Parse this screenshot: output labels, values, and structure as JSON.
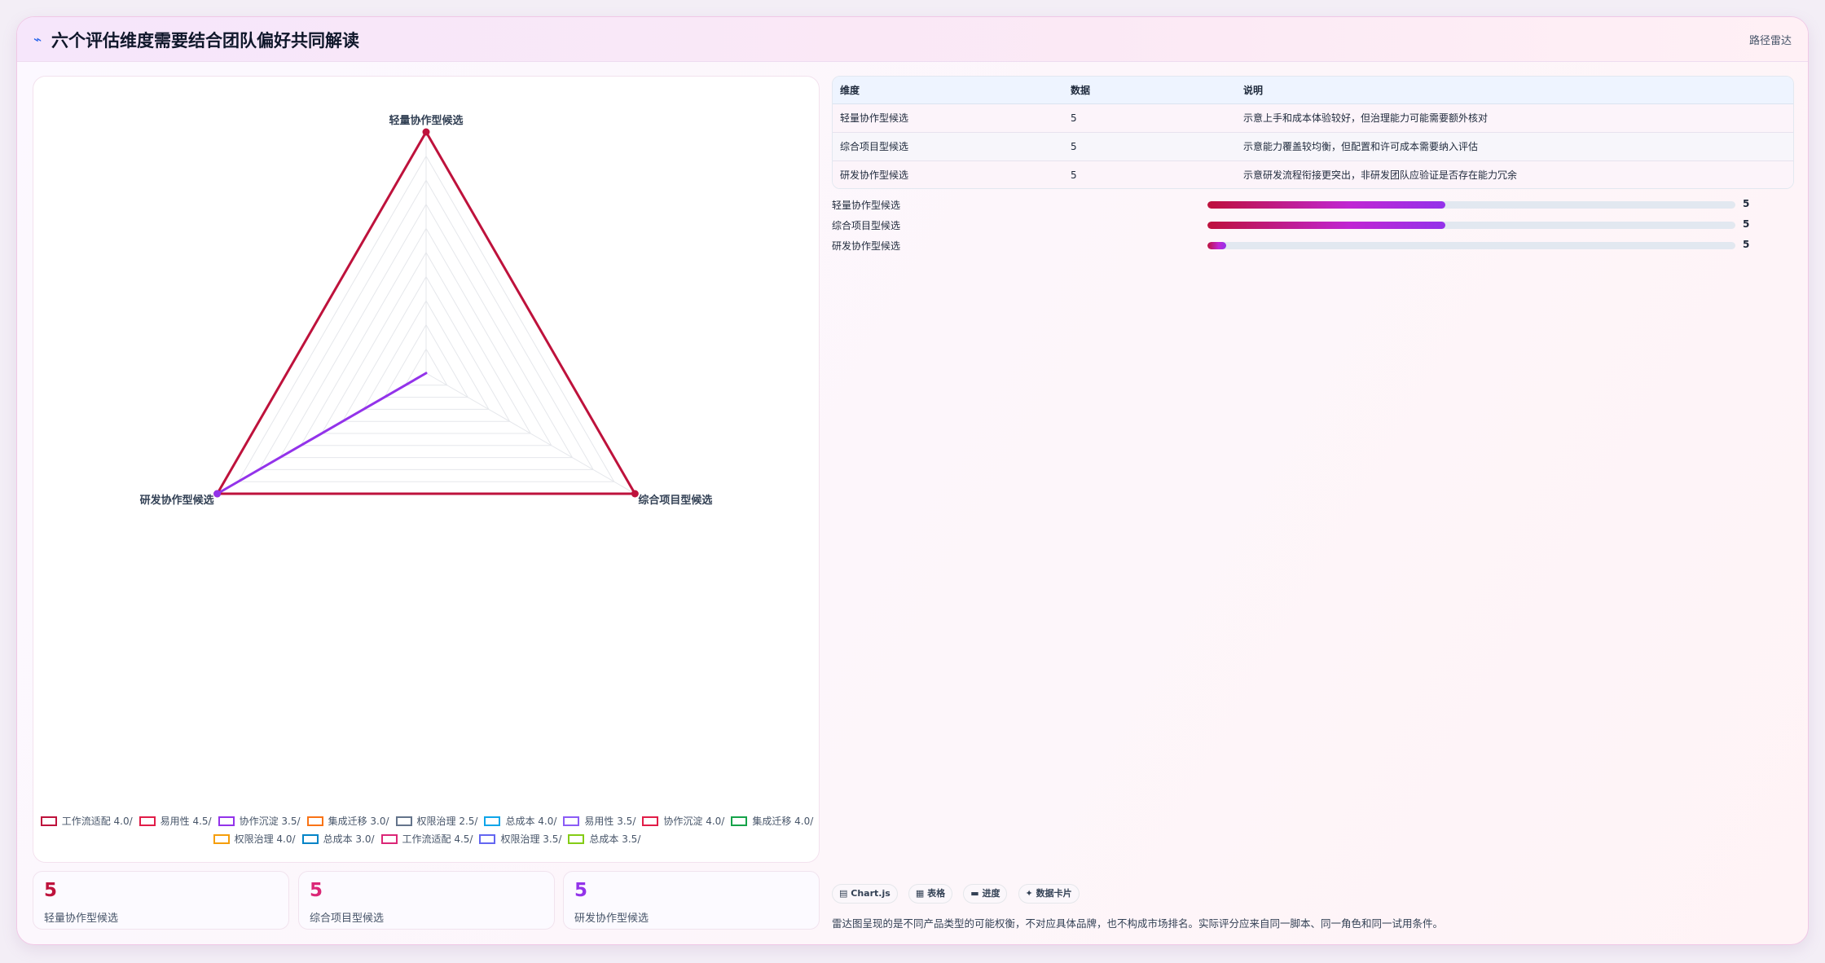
{
  "header": {
    "icon": "chart-tilde-icon",
    "title": "六个评估维度需要结合团队偏好共同解读",
    "tag": "路径雷达"
  },
  "chart_data": {
    "type": "radar",
    "axes": [
      "轻量协作型候选",
      "综合项目型候选",
      "研发协作型候选"
    ],
    "r_range": [
      0,
      5
    ],
    "grid": true,
    "legend_placement": "bottom",
    "series": [
      {
        "name": "工作流适配 4.0/",
        "color": "#be123c",
        "values": [
          5,
          5,
          5
        ]
      },
      {
        "name": "易用性 4.5/",
        "color": "#e11d48",
        "values": [
          null,
          null,
          null
        ]
      },
      {
        "name": "协作沉淀 3.5/",
        "color": "#9333ea",
        "values": [
          0,
          0,
          5
        ]
      },
      {
        "name": "集成迁移 3.0/",
        "color": "#f97316",
        "values": [
          null,
          null,
          null
        ]
      },
      {
        "name": "权限治理 2.5/",
        "color": "#64748b",
        "values": [
          null,
          null,
          null
        ]
      },
      {
        "name": "总成本 4.0/",
        "color": "#0ea5e9",
        "values": [
          null,
          null,
          null
        ]
      },
      {
        "name": "易用性 3.5/",
        "color": "#8b5cf6",
        "values": [
          null,
          null,
          null
        ]
      },
      {
        "name": "协作沉淀 4.0/",
        "color": "#e11d48",
        "values": [
          null,
          null,
          null
        ]
      },
      {
        "name": "集成迁移 4.0/",
        "color": "#16a34a",
        "values": [
          null,
          null,
          null
        ]
      },
      {
        "name": "权限治理 4.0/",
        "color": "#f59e0b",
        "values": [
          null,
          null,
          null
        ]
      },
      {
        "name": "总成本 3.0/",
        "color": "#0284c7",
        "values": [
          null,
          null,
          null
        ]
      },
      {
        "name": "工作流适配 4.5/",
        "color": "#db2777",
        "values": [
          null,
          null,
          null
        ]
      },
      {
        "name": "权限治理 3.5/",
        "color": "#6366f1",
        "values": [
          null,
          null,
          null
        ]
      },
      {
        "name": "总成本 3.5/",
        "color": "#84cc16",
        "values": [
          null,
          null,
          null
        ]
      }
    ]
  },
  "stats": [
    {
      "value": "5",
      "label": "轻量协作型候选",
      "color": "#be123c"
    },
    {
      "value": "5",
      "label": "综合项目型候选",
      "color": "#db2777"
    },
    {
      "value": "5",
      "label": "研发协作型候选",
      "color": "#9333ea"
    }
  ],
  "table": {
    "headers": [
      "维度",
      "数据",
      "说明"
    ],
    "rows": [
      [
        "轻量协作型候选",
        "5",
        "示意上手和成本体验较好，但治理能力可能需要额外核对"
      ],
      [
        "综合项目型候选",
        "5",
        "示意能力覆盖较均衡，但配置和许可成本需要纳入评估"
      ],
      [
        "研发协作型候选",
        "5",
        "示意研发流程衔接更突出，非研发团队应验证是否存在能力冗余"
      ]
    ]
  },
  "progress": [
    {
      "label": "轻量协作型候选",
      "value": "5",
      "fraction": 0.45
    },
    {
      "label": "综合项目型候选",
      "value": "5",
      "fraction": 0.45
    },
    {
      "label": "研发协作型候选",
      "value": "5",
      "fraction": 0.035
    }
  ],
  "chips": [
    {
      "icon": "chart-icon",
      "glyph": "▤",
      "label": "Chart.js"
    },
    {
      "icon": "table-icon",
      "glyph": "▦",
      "label": "表格"
    },
    {
      "icon": "progress-icon",
      "glyph": "▬",
      "label": "进度"
    },
    {
      "icon": "card-icon",
      "glyph": "✦",
      "label": "数据卡片"
    }
  ],
  "footnote": "雷达图呈现的是不同产品类型的可能权衡，不对应具体品牌，也不构成市场排名。实际评分应来自同一脚本、同一角色和同一试用条件。"
}
